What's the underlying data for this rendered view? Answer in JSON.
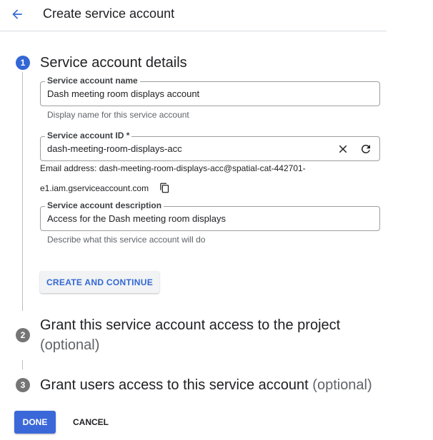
{
  "header": {
    "title": "Create service account"
  },
  "steps": [
    {
      "number": "1",
      "title": "Service account details"
    },
    {
      "number": "2",
      "title": "Grant this service account access to the project",
      "optional": "(optional)"
    },
    {
      "number": "3",
      "title": "Grant users access to this service account",
      "optional": "(optional)"
    }
  ],
  "form": {
    "name": {
      "label": "Service account name",
      "value": "Dash meeting room displays account",
      "helper": "Display name for this service account"
    },
    "id": {
      "label": "Service account ID *",
      "value": "dash-meeting-room-displays-acc",
      "email_line1": "Email address: dash-meeting-room-displays-acc@spatial-cat-442701-",
      "email_line2": "e1.iam.gserviceaccount.com"
    },
    "description": {
      "label": "Service account description",
      "value": "Access for the Dash meeting room displays",
      "helper": "Describe what this service account will do"
    }
  },
  "buttons": {
    "create_continue": "CREATE AND CONTINUE",
    "done": "DONE",
    "cancel": "CANCEL"
  },
  "colors": {
    "accent": "#3367d6",
    "inactive_step": "#757575"
  }
}
